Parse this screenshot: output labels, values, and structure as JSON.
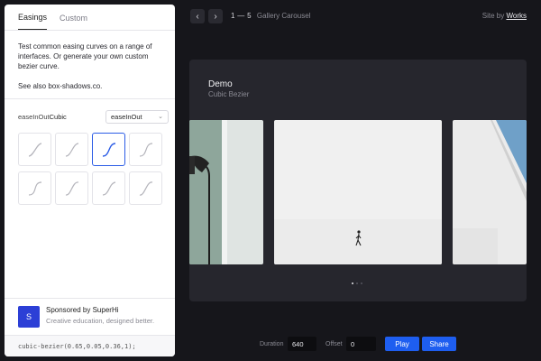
{
  "sidebar": {
    "tabs": [
      {
        "label": "Easings"
      },
      {
        "label": "Custom"
      }
    ],
    "intro": {
      "line1": "Test common easing curves on a range of interfaces. Or generate your own custom bezier curve.",
      "see_also": "See also box-shadows.co."
    },
    "easing": {
      "label_prefix": "easeInOut",
      "label_suffix": "Cubic",
      "select_value": "easeInOut"
    },
    "sponsor": {
      "logo": "S",
      "title": "Sponsored by SuperHi",
      "subtitle": "Creative education, designed better."
    },
    "code": "cubic-bezier(0.65,0.05,0.36,1);"
  },
  "topbar": {
    "prev_icon": "‹",
    "next_icon": "›",
    "counter": "1 — 5",
    "gallery_title": "Gallery Carousel",
    "site_by": "Site by",
    "works": "Works"
  },
  "demo": {
    "title": "Demo",
    "subtitle": "Cubic Bezier"
  },
  "controls": {
    "duration_label": "Duration",
    "duration_value": "640",
    "offset_label": "Offset",
    "offset_value": "0",
    "play_label": "Play",
    "share_label": "Share"
  },
  "colors": {
    "accent": "#1e5ef0",
    "active_cell": "#2b5ce6",
    "background": "#16161b",
    "panel": "#26262d"
  }
}
